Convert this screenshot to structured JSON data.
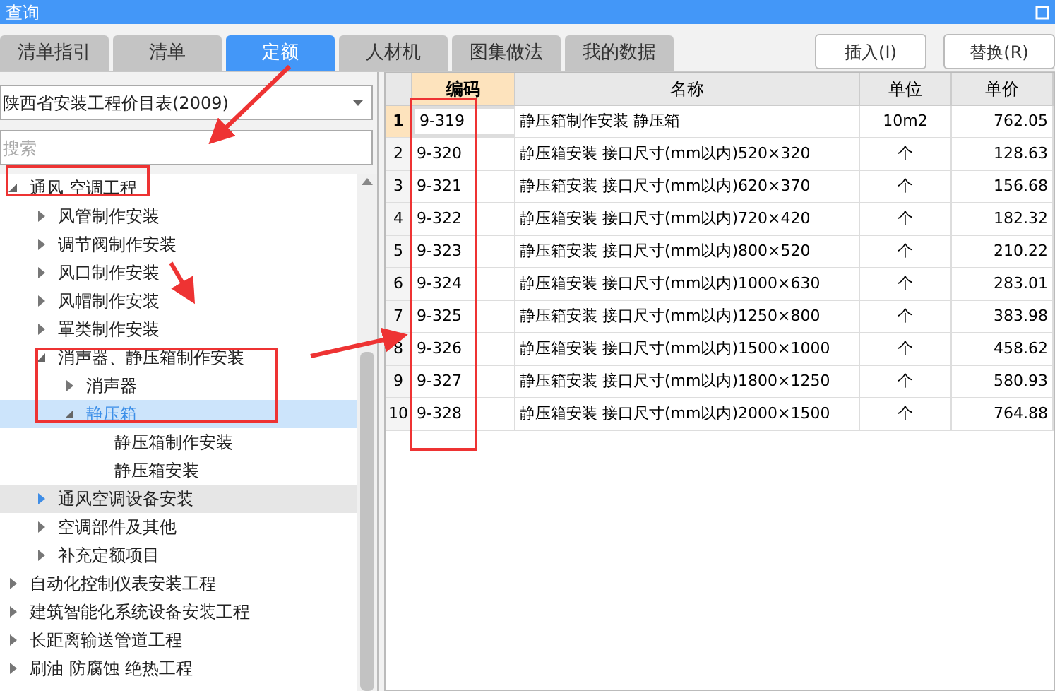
{
  "window": {
    "title": "查询"
  },
  "tabs": [
    {
      "label": "清单指引",
      "selected": false
    },
    {
      "label": "清单",
      "selected": false
    },
    {
      "label": "定额",
      "selected": true
    },
    {
      "label": "人材机",
      "selected": false
    },
    {
      "label": "图集做法",
      "selected": false
    },
    {
      "label": "我的数据",
      "selected": false
    }
  ],
  "buttons": [
    "插入(I)",
    "替换(R)"
  ],
  "library_select": {
    "value": "陕西省安装工程价目表(2009)"
  },
  "search": {
    "placeholder": "搜索"
  },
  "tree": [
    {
      "label": "通风 空调工程",
      "expanded": true,
      "selected": false,
      "hovered": false,
      "children": [
        {
          "label": "风管制作安装",
          "expanded": false,
          "selected": false,
          "hovered": false
        },
        {
          "label": "调节阀制作安装",
          "expanded": false,
          "selected": false,
          "hovered": false
        },
        {
          "label": "风口制作安装",
          "expanded": false,
          "selected": false,
          "hovered": false
        },
        {
          "label": "风帽制作安装",
          "expanded": false,
          "selected": false,
          "hovered": false
        },
        {
          "label": "罩类制作安装",
          "expanded": false,
          "selected": false,
          "hovered": false
        },
        {
          "label": "消声器、静压箱制作安装",
          "expanded": true,
          "selected": false,
          "hovered": false,
          "children": [
            {
              "label": "消声器",
              "expanded": false,
              "selected": false,
              "hovered": false
            },
            {
              "label": "静压箱",
              "expanded": true,
              "selected": true,
              "hovered": false,
              "children": [
                {
                  "label": "静压箱制作安装",
                  "selected": false,
                  "hovered": false
                },
                {
                  "label": "静压箱安装",
                  "selected": false,
                  "hovered": false
                }
              ]
            }
          ]
        },
        {
          "label": "通风空调设备安装",
          "expanded": false,
          "selected": false,
          "hovered": true
        },
        {
          "label": "空调部件及其他",
          "expanded": false,
          "selected": false,
          "hovered": false
        },
        {
          "label": "补充定额项目",
          "expanded": false,
          "selected": false,
          "hovered": false
        }
      ]
    },
    {
      "label": "自动化控制仪表安装工程",
      "expanded": false,
      "selected": false,
      "hovered": false
    },
    {
      "label": "建筑智能化系统设备安装工程",
      "expanded": false,
      "selected": false,
      "hovered": false
    },
    {
      "label": "长距离输送管道工程",
      "expanded": false,
      "selected": false,
      "hovered": false
    },
    {
      "label": "刷油 防腐蚀 绝热工程",
      "expanded": false,
      "selected": false,
      "hovered": false
    }
  ],
  "table": {
    "columns": [
      "编码",
      "名称",
      "单位",
      "单价"
    ],
    "rows": [
      {
        "index": "1",
        "selected": true,
        "cells": [
          "9-319",
          "静压箱制作安装 静压箱",
          "10m2",
          "762.05"
        ]
      },
      {
        "index": "2",
        "selected": false,
        "cells": [
          "9-320",
          "静压箱安装 接口尺寸(mm以内)520×320",
          "个",
          "128.63"
        ]
      },
      {
        "index": "3",
        "selected": false,
        "cells": [
          "9-321",
          "静压箱安装 接口尺寸(mm以内)620×370",
          "个",
          "156.68"
        ]
      },
      {
        "index": "4",
        "selected": false,
        "cells": [
          "9-322",
          "静压箱安装 接口尺寸(mm以内)720×420",
          "个",
          "182.32"
        ]
      },
      {
        "index": "5",
        "selected": false,
        "cells": [
          "9-323",
          "静压箱安装 接口尺寸(mm以内)800×520",
          "个",
          "210.22"
        ]
      },
      {
        "index": "6",
        "selected": false,
        "cells": [
          "9-324",
          "静压箱安装 接口尺寸(mm以内)1000×630",
          "个",
          "283.01"
        ]
      },
      {
        "index": "7",
        "selected": false,
        "cells": [
          "9-325",
          "静压箱安装 接口尺寸(mm以内)1250×800",
          "个",
          "383.98"
        ]
      },
      {
        "index": "8",
        "selected": false,
        "cells": [
          "9-326",
          "静压箱安装 接口尺寸(mm以内)1500×1000",
          "个",
          "458.62"
        ]
      },
      {
        "index": "9",
        "selected": false,
        "cells": [
          "9-327",
          "静压箱安装 接口尺寸(mm以内)1800×1250",
          "个",
          "580.93"
        ]
      },
      {
        "index": "10",
        "selected": false,
        "cells": [
          "9-328",
          "静压箱安装 接口尺寸(mm以内)2000×1500",
          "个",
          "764.88"
        ]
      }
    ]
  }
}
